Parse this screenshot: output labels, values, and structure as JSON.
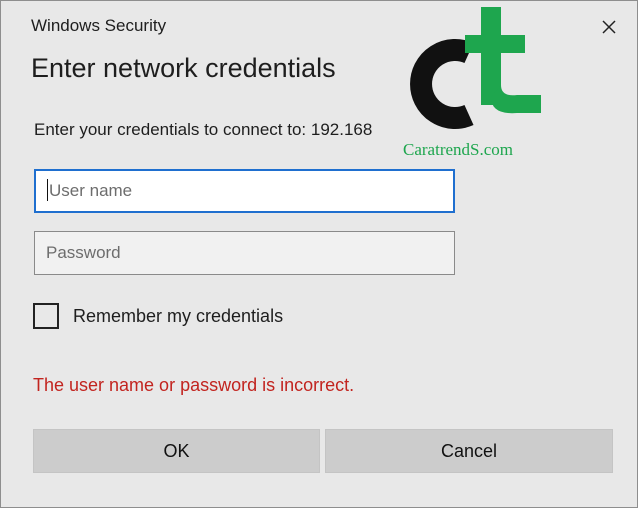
{
  "window": {
    "title": "Windows Security"
  },
  "dialog": {
    "heading": "Enter network credentials",
    "prompt": "Enter your credentials to connect to: 192.168",
    "username_placeholder": "User name",
    "password_placeholder": "Password",
    "remember_label": "Remember my credentials",
    "remember_checked": false,
    "error": "The user name or password is incorrect.",
    "ok_label": "OK",
    "cancel_label": "Cancel"
  },
  "watermark": {
    "logo_text": "ct",
    "site": "CaratrendS.com"
  },
  "colors": {
    "error": "#c2241f",
    "focus": "#1f6fcf",
    "logo_green": "#1ea64e"
  }
}
